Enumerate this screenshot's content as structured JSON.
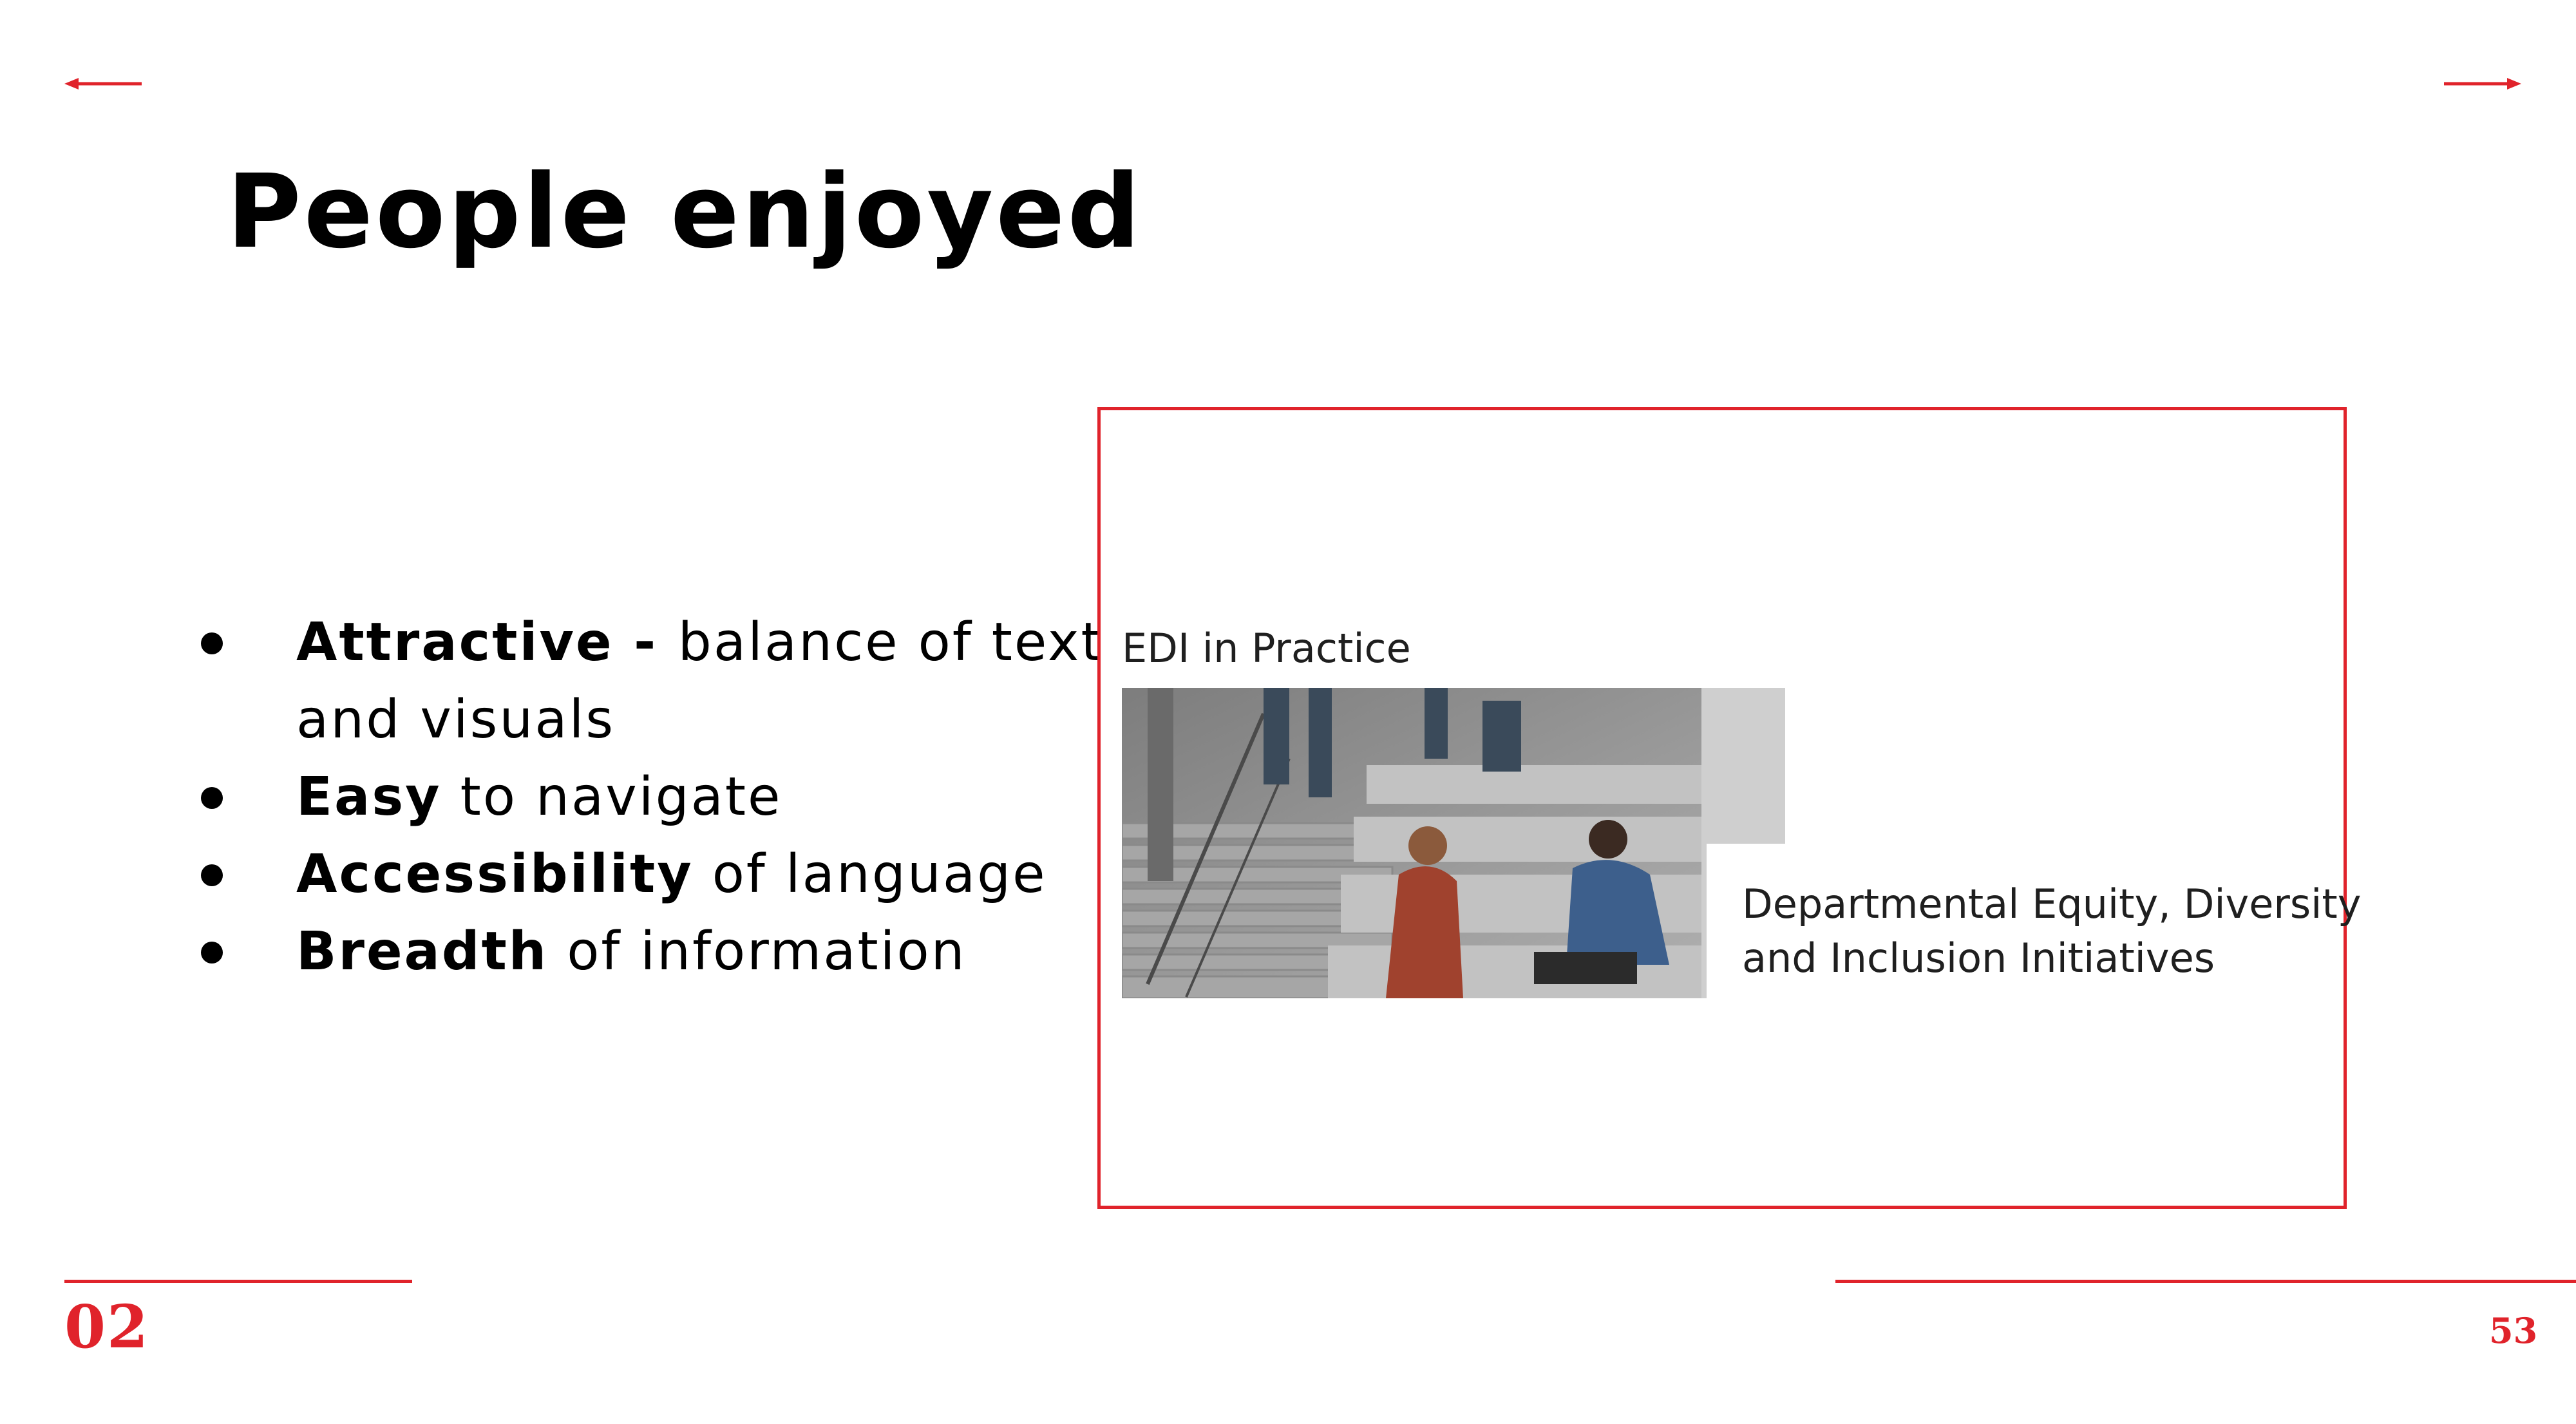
{
  "slide": {
    "title": "People enjoyed",
    "bullets": [
      {
        "lead": "Attractive",
        "sep": " - ",
        "rest": "balance of text",
        "cont": "and visuals"
      },
      {
        "lead": "Easy",
        "rest": " to navigate"
      },
      {
        "lead": "Accessibility",
        "rest": " of language"
      },
      {
        "lead": "Breadth",
        "rest": " of information"
      }
    ],
    "card": {
      "label": "EDI in Practice",
      "caption_line1": "Departmental Equity, Diversity",
      "caption_line2": "and Inclusion Initiatives"
    },
    "footer": {
      "section": "02",
      "page": "53"
    }
  },
  "colors": {
    "accent": "#e0232b",
    "text": "#000000"
  },
  "icons": {
    "nav_prev": "arrow-left-icon",
    "nav_next": "arrow-right-icon"
  }
}
